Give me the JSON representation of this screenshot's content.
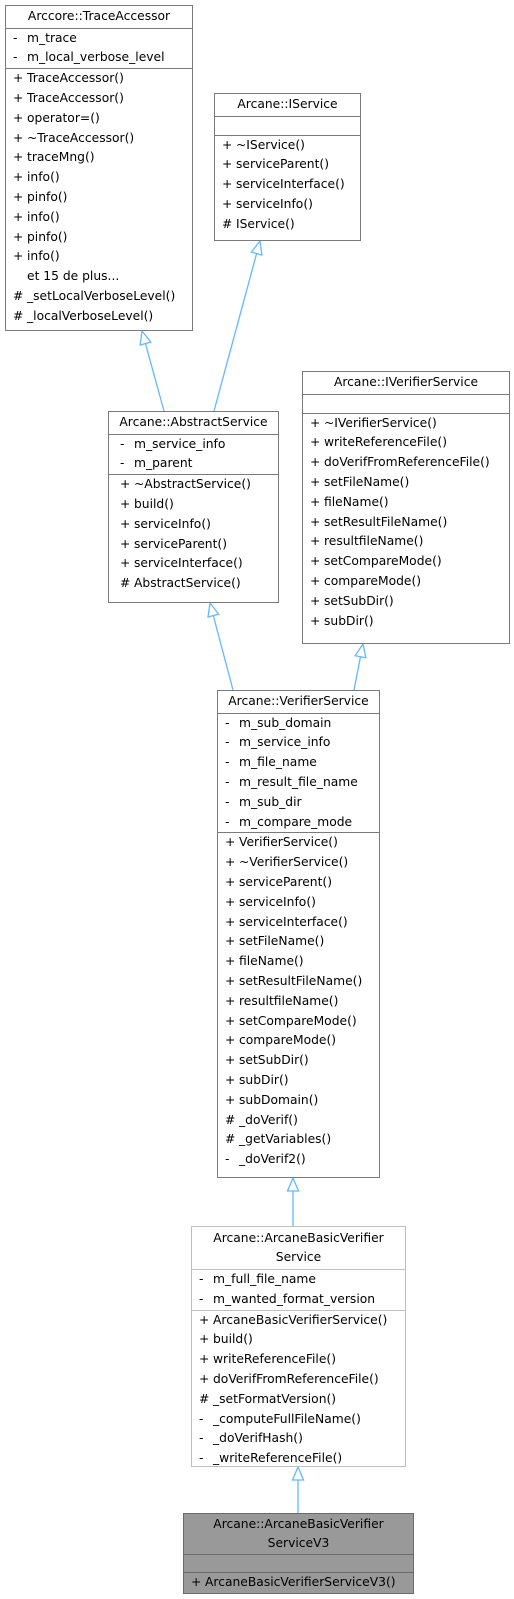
{
  "diagram": {
    "type": "class-inheritance",
    "edge_color": "#63b8ff",
    "classes": {
      "trace_accessor": {
        "name": "Arccore::TraceAccessor",
        "attributes": [
          {
            "vis": "-",
            "name": "m_trace"
          },
          {
            "vis": "-",
            "name": "m_local_verbose_level"
          }
        ],
        "methods": [
          {
            "vis": "+",
            "name": "TraceAccessor()"
          },
          {
            "vis": "+",
            "name": "TraceAccessor()"
          },
          {
            "vis": "+",
            "name": "operator=()"
          },
          {
            "vis": "+",
            "name": "~TraceAccessor()"
          },
          {
            "vis": "+",
            "name": "traceMng()"
          },
          {
            "vis": "+",
            "name": "info()"
          },
          {
            "vis": "+",
            "name": "pinfo()"
          },
          {
            "vis": "+",
            "name": "info()"
          },
          {
            "vis": "+",
            "name": "pinfo()"
          },
          {
            "vis": "+",
            "name": "info()"
          },
          {
            "vis": "",
            "name": "et 15 de plus..."
          },
          {
            "vis": "#",
            "name": "_setLocalVerboseLevel()"
          },
          {
            "vis": "#",
            "name": "_localVerboseLevel()"
          }
        ]
      },
      "iservice": {
        "name": "Arcane::IService",
        "attributes": [],
        "methods": [
          {
            "vis": "+",
            "name": "~IService()"
          },
          {
            "vis": "+",
            "name": "serviceParent()"
          },
          {
            "vis": "+",
            "name": "serviceInterface()"
          },
          {
            "vis": "+",
            "name": "serviceInfo()"
          },
          {
            "vis": "#",
            "name": "IService()"
          }
        ]
      },
      "abstract_service": {
        "name": "Arcane::AbstractService",
        "attributes": [
          {
            "vis": "-",
            "name": "m_service_info"
          },
          {
            "vis": "-",
            "name": "m_parent"
          }
        ],
        "methods": [
          {
            "vis": "+",
            "name": "~AbstractService()"
          },
          {
            "vis": "+",
            "name": "build()"
          },
          {
            "vis": "+",
            "name": "serviceInfo()"
          },
          {
            "vis": "+",
            "name": "serviceParent()"
          },
          {
            "vis": "+",
            "name": "serviceInterface()"
          },
          {
            "vis": "#",
            "name": "AbstractService()"
          }
        ]
      },
      "iverifier_service": {
        "name": "Arcane::IVerifierService",
        "attributes": [],
        "methods": [
          {
            "vis": "+",
            "name": "~IVerifierService()"
          },
          {
            "vis": "+",
            "name": "writeReferenceFile()"
          },
          {
            "vis": "+",
            "name": "doVerifFromReferenceFile()"
          },
          {
            "vis": "+",
            "name": "setFileName()"
          },
          {
            "vis": "+",
            "name": "fileName()"
          },
          {
            "vis": "+",
            "name": "setResultFileName()"
          },
          {
            "vis": "+",
            "name": "resultfileName()"
          },
          {
            "vis": "+",
            "name": "setCompareMode()"
          },
          {
            "vis": "+",
            "name": "compareMode()"
          },
          {
            "vis": "+",
            "name": "setSubDir()"
          },
          {
            "vis": "+",
            "name": "subDir()"
          }
        ]
      },
      "verifier_service": {
        "name": "Arcane::VerifierService",
        "attributes": [
          {
            "vis": "-",
            "name": "m_sub_domain"
          },
          {
            "vis": "-",
            "name": "m_service_info"
          },
          {
            "vis": "-",
            "name": "m_file_name"
          },
          {
            "vis": "-",
            "name": "m_result_file_name"
          },
          {
            "vis": "-",
            "name": "m_sub_dir"
          },
          {
            "vis": "-",
            "name": "m_compare_mode"
          }
        ],
        "methods": [
          {
            "vis": "+",
            "name": "VerifierService()"
          },
          {
            "vis": "+",
            "name": "~VerifierService()"
          },
          {
            "vis": "+",
            "name": "serviceParent()"
          },
          {
            "vis": "+",
            "name": "serviceInfo()"
          },
          {
            "vis": "+",
            "name": "serviceInterface()"
          },
          {
            "vis": "+",
            "name": "setFileName()"
          },
          {
            "vis": "+",
            "name": "fileName()"
          },
          {
            "vis": "+",
            "name": "setResultFileName()"
          },
          {
            "vis": "+",
            "name": "resultfileName()"
          },
          {
            "vis": "+",
            "name": "setCompareMode()"
          },
          {
            "vis": "+",
            "name": "compareMode()"
          },
          {
            "vis": "+",
            "name": "setSubDir()"
          },
          {
            "vis": "+",
            "name": "subDir()"
          },
          {
            "vis": "+",
            "name": "subDomain()"
          },
          {
            "vis": "#",
            "name": "_doVerif()"
          },
          {
            "vis": "#",
            "name": "_getVariables()"
          },
          {
            "vis": "-",
            "name": "_doVerif2()"
          }
        ]
      },
      "arcane_basic_verifier_service": {
        "name_line1": "Arcane::ArcaneBasicVerifier",
        "name_line2": "Service",
        "attributes": [
          {
            "vis": "-",
            "name": "m_full_file_name"
          },
          {
            "vis": "-",
            "name": "m_wanted_format_version"
          }
        ],
        "methods": [
          {
            "vis": "+",
            "name": "ArcaneBasicVerifierService()"
          },
          {
            "vis": "+",
            "name": "build()"
          },
          {
            "vis": "+",
            "name": "writeReferenceFile()"
          },
          {
            "vis": "+",
            "name": "doVerifFromReferenceFile()"
          },
          {
            "vis": "#",
            "name": "_setFormatVersion()"
          },
          {
            "vis": "-",
            "name": "_computeFullFileName()"
          },
          {
            "vis": "-",
            "name": "_doVerifHash()"
          },
          {
            "vis": "-",
            "name": "_writeReferenceFile()"
          }
        ]
      },
      "arcane_basic_verifier_service_v3": {
        "name_line1": "Arcane::ArcaneBasicVerifier",
        "name_line2": "ServiceV3",
        "attributes": [],
        "methods": [
          {
            "vis": "+",
            "name": "ArcaneBasicVerifierServiceV3()"
          }
        ]
      }
    },
    "edges": [
      {
        "from": "abstract_service",
        "to": "trace_accessor",
        "kind": "inherits"
      },
      {
        "from": "abstract_service",
        "to": "iservice",
        "kind": "inherits"
      },
      {
        "from": "verifier_service",
        "to": "abstract_service",
        "kind": "inherits"
      },
      {
        "from": "verifier_service",
        "to": "iverifier_service",
        "kind": "inherits"
      },
      {
        "from": "arcane_basic_verifier_service",
        "to": "verifier_service",
        "kind": "inherits"
      },
      {
        "from": "arcane_basic_verifier_service_v3",
        "to": "arcane_basic_verifier_service",
        "kind": "inherits"
      }
    ]
  }
}
